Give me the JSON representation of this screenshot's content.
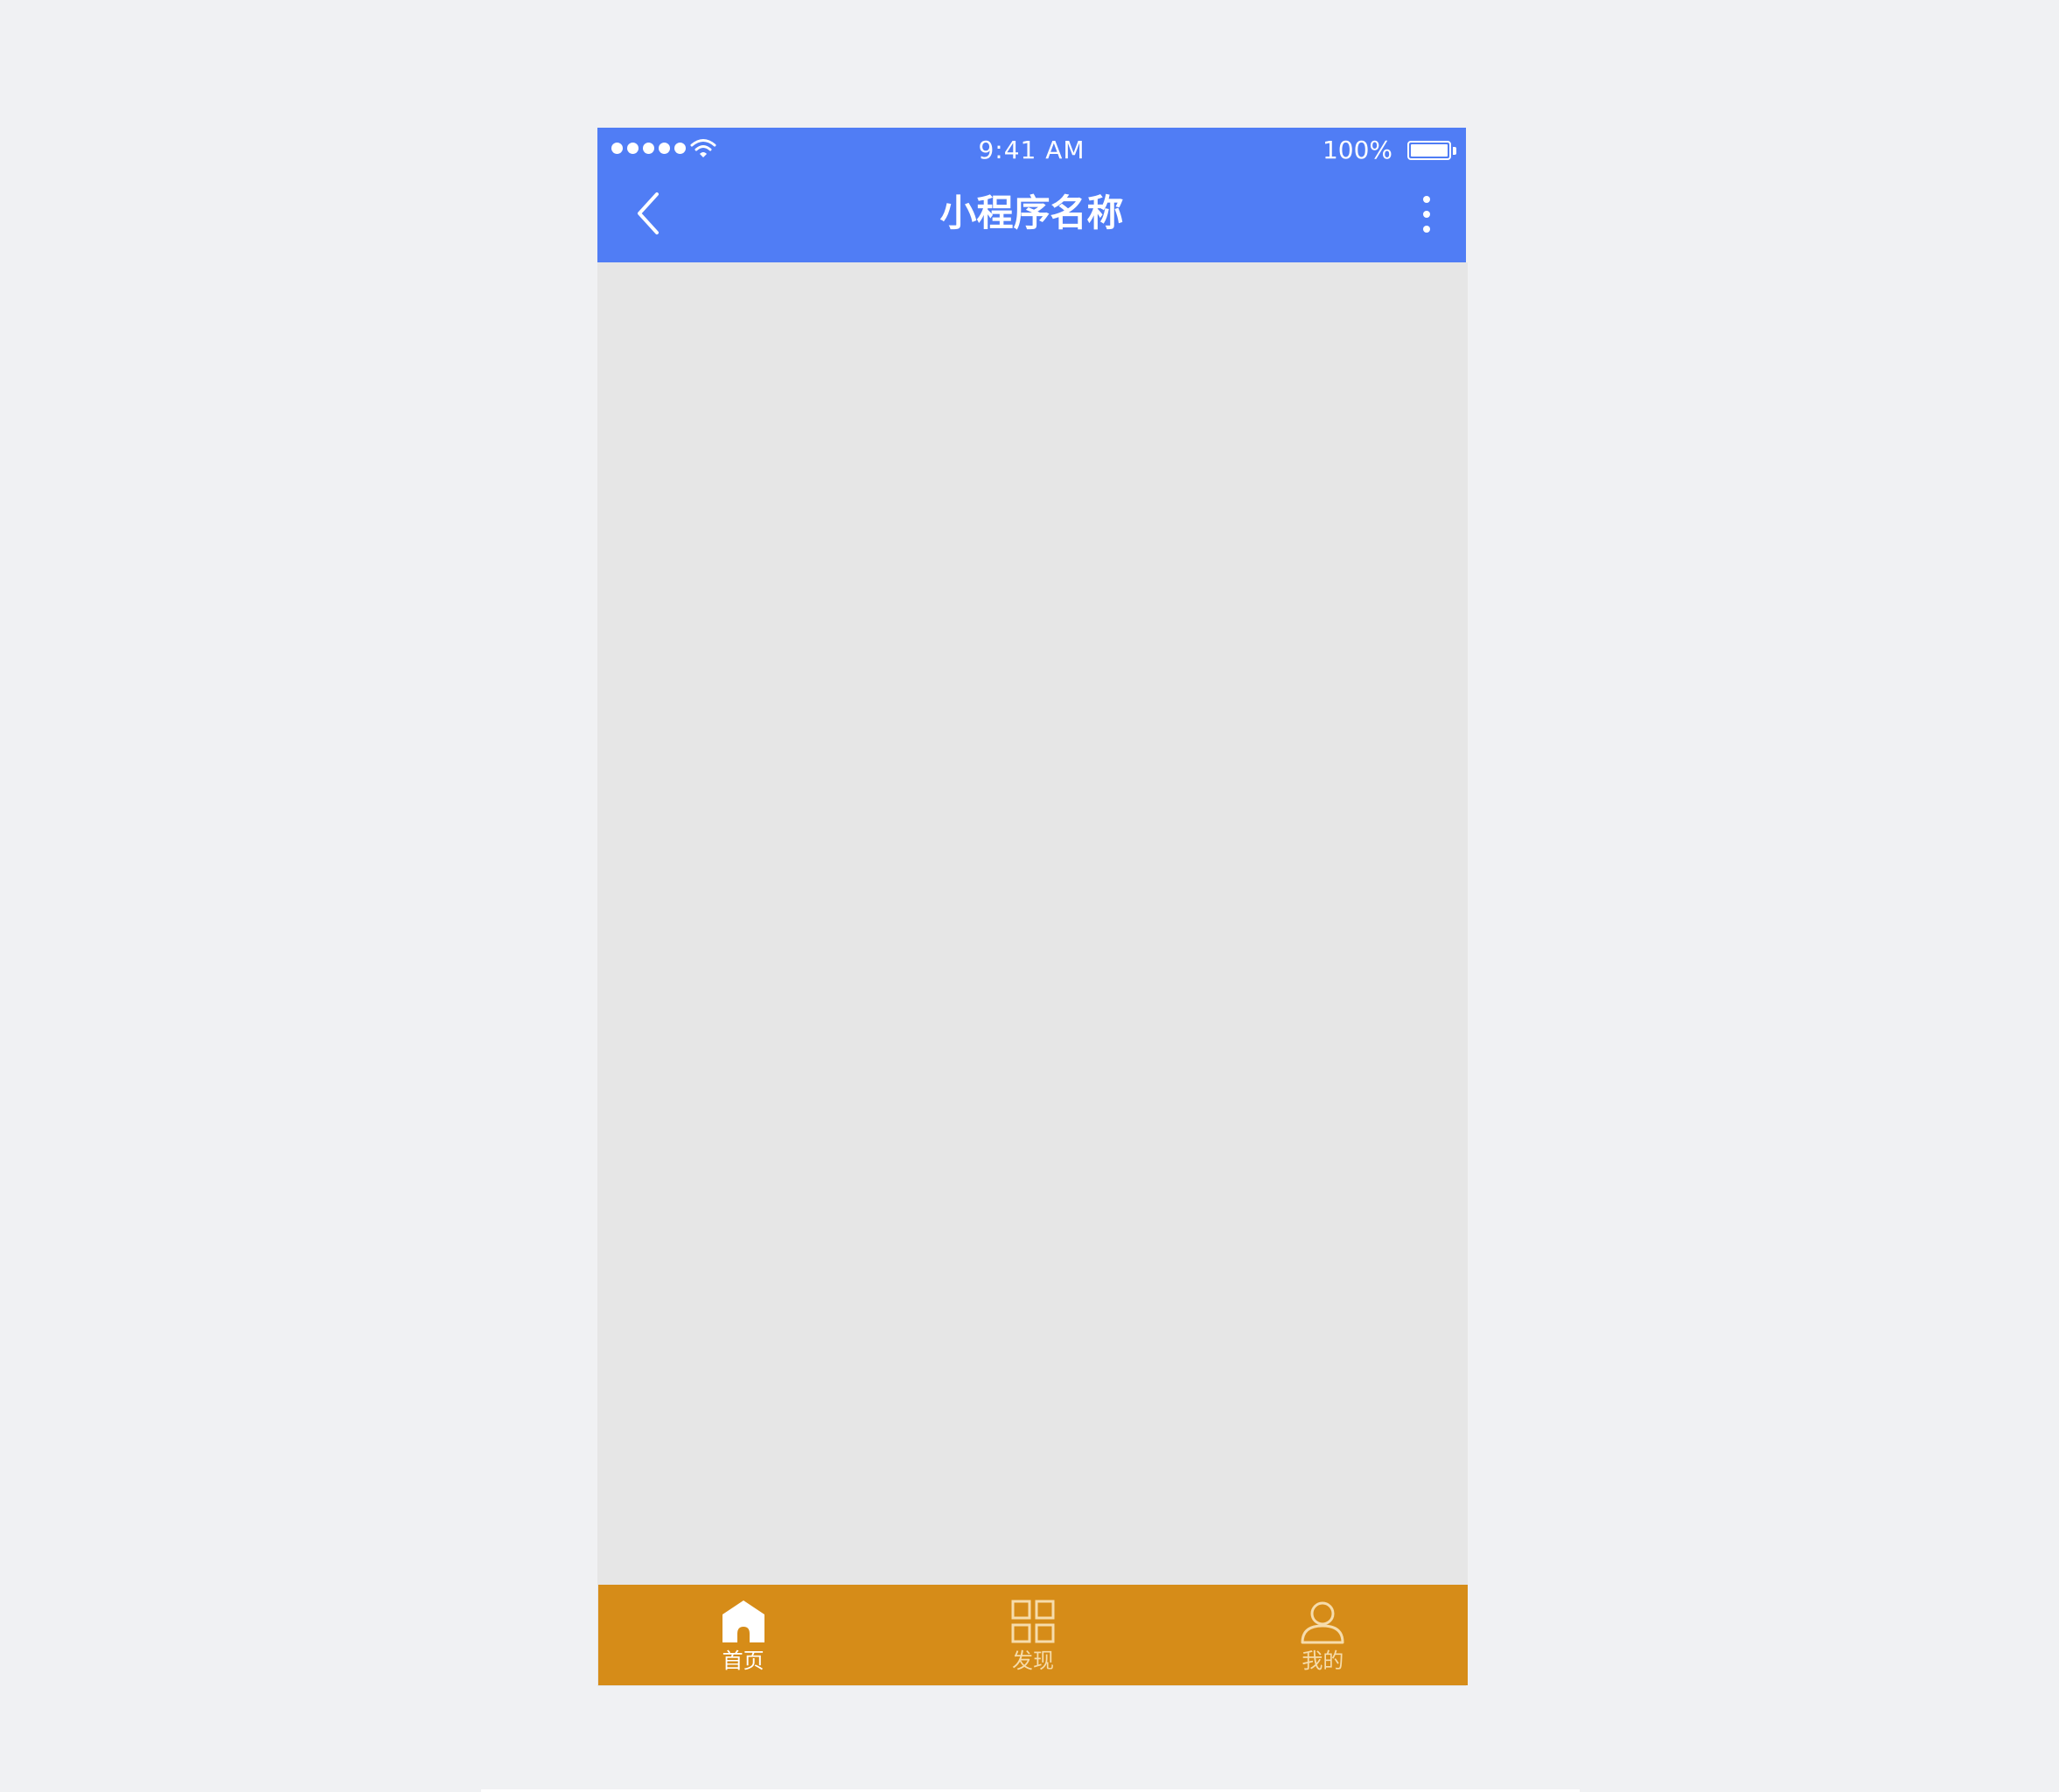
{
  "status_bar": {
    "time": "9:41 AM",
    "battery": "100%",
    "signal_icon": "signal-dots-icon",
    "wifi_icon": "wifi-icon",
    "battery_icon": "battery-icon",
    "battery_level": 1.0
  },
  "nav_bar": {
    "title": "小程序名称",
    "back_icon": "chevron-left-icon",
    "more_icon": "more-vertical-icon"
  },
  "tab_bar": {
    "items": [
      {
        "label": "首页",
        "icon": "home-icon",
        "active": true
      },
      {
        "label": "发现",
        "icon": "grid-icon",
        "active": false
      },
      {
        "label": "我的",
        "icon": "user-icon",
        "active": false
      }
    ]
  },
  "colors": {
    "page_background": "#f0f1f3",
    "nav_background": "#507df5",
    "content_background": "#e6e6e6",
    "tab_bar_background": "#d68c18",
    "tab_active": "#ffffff",
    "tab_inactive": "#f6dcab"
  }
}
